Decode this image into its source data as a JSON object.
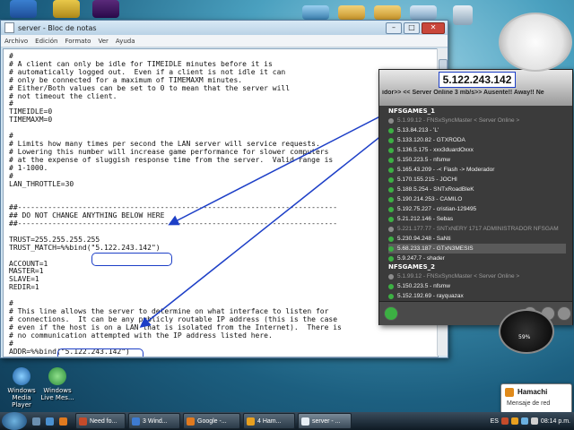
{
  "notepad": {
    "title": "server - Bloc de notas",
    "menu": [
      "Archivo",
      "Edición",
      "Formato",
      "Ver",
      "Ayuda"
    ],
    "content": "#\n# A client can only be idle for TIMEIDLE minutes before it is\n# automatically logged out.  Even if a client is not idle it can\n# only be connected for a maximum of TIMEMAXM minutes.\n# Either/Both values can be set to 0 to mean that the server will\n# not timeout the client.\n#\nTIMEIDLE=0\nTIMEMAXM=0\n\n#\n# Limits how many times per second the LAN server will service requests.\n# Lowering this number will increase game performance for slower computers\n# at the expense of sluggish response time from the server.  Valid range is\n# 1-1000.\n#\nLAN_THROTTLE=30\n\n\n##--------------------------------------------------------------------------\n## DO NOT CHANGE ANYTHING BELOW HERE\n##--------------------------------------------------------------------------\n\nTRUST=255.255.255.255\nTRUST_MATCH=%%bind(\"5.122.243.142\")\n\nACCOUNT=1\nMASTER=1\nSLAVE=1\nREDIR=1\n\n#\n# This line allows the server to determine on what interface to listen for\n# connections.  It can be any publicly routable IP address (this is the case\n# even if the host is on a LAN that is isolated from the Internet).  There is\n# no communication attempted with the IP address listed here.\n#\nADDR=%%bind(\"5.122.243.142\")"
  },
  "hamachi": {
    "ip": "5.122.243.142",
    "status": "idor>> << Server Online 3 mb/s>> Ausente!! Away!! Ne",
    "groups": [
      {
        "name": "NFSGAMES_1",
        "members": [
          {
            "text": "5.1.99.12 - FNSxSyncMaster < Server Online >",
            "online": false
          },
          {
            "text": "5.13.84.213 - 'L'",
            "online": true
          },
          {
            "text": "5.133.120.82 - GTXRODA",
            "online": true
          },
          {
            "text": "5.136.5.175 - xxx3duardOxxx",
            "online": true
          },
          {
            "text": "5.150.223.5 - nfsmw",
            "online": true
          },
          {
            "text": "5.165.43.209 - -< Flash -> Moderador",
            "online": true
          },
          {
            "text": "5.170.155.215 - JOCHI",
            "online": true
          },
          {
            "text": "5.188.5.254 - SNTxRoadBleK",
            "online": true
          },
          {
            "text": "5.190.214.253 - CAMILO",
            "online": true
          },
          {
            "text": "5.192.75.227 - cristian-129495",
            "online": true
          },
          {
            "text": "5.21.212.146 - Sebas",
            "online": true
          },
          {
            "text": "5.221.177.77 - SNTxNERY 1717 ADMINISTRADOR NFSGAM",
            "online": false
          },
          {
            "text": "5.230.94.248 - SaNti",
            "online": true
          },
          {
            "text": "5.68.233.187 - GTxN3MESIS",
            "online": true,
            "selected": true
          },
          {
            "text": "5.9.247.7 - shader",
            "online": true
          }
        ]
      },
      {
        "name": "NFSGAMES_2",
        "members": [
          {
            "text": "5.1.99.12 - FNSxSyncMaster < Server Online >",
            "online": false
          },
          {
            "text": "5.150.223.5 - nfsmw",
            "online": true
          },
          {
            "text": "5.152.192.69 - rayquazax",
            "online": true
          },
          {
            "text": "5.165.43.209 - -< Flash -> Moderador",
            "online": true
          }
        ]
      }
    ]
  },
  "desktop_icons": [
    {
      "label": "Windows Media Player"
    },
    {
      "label": "Windows Live Mes..."
    }
  ],
  "gauge": {
    "value": "59%"
  },
  "notification": {
    "title": "Hamachi",
    "subtitle": "Mensaje de red"
  },
  "taskbar": {
    "buttons": [
      {
        "label": "Need fo...",
        "color": "#c44b2a"
      },
      {
        "label": "3 Wind...",
        "color": "#3d7bd1"
      },
      {
        "label": "Google -...",
        "color": "#e07a1f"
      },
      {
        "label": "4 Ham...",
        "color": "#e8a020"
      },
      {
        "label": "server - ...",
        "color": "#e6eef5"
      }
    ],
    "language": "ES",
    "clock": "08:14 p.m."
  },
  "colors": {
    "annotation_blue": "#1d3fc7",
    "online_green": "#3cb043",
    "offline_grey": "#8c8c8c"
  }
}
